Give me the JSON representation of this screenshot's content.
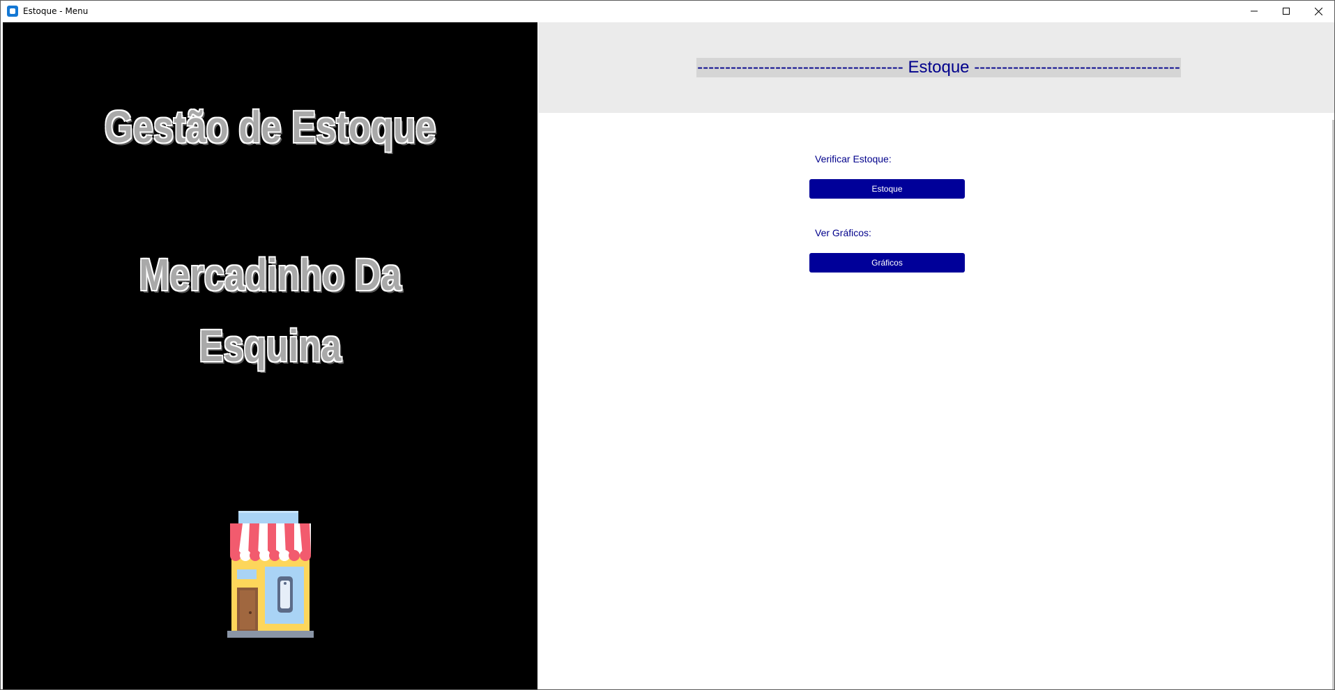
{
  "window": {
    "title": "Estoque - Menu",
    "controls": [
      "minimize-icon",
      "maximize-icon",
      "close-icon"
    ]
  },
  "left_panel": {
    "heading_line1": "Gestão de Estoque",
    "heading_line2": "Mercadinho Da",
    "heading_line3": "Esquina",
    "image": "storefront-icon"
  },
  "right_panel": {
    "header": "------------------------------------- Estoque -------------------------------------",
    "verificar_label": "Verificar Estoque:",
    "estoque_button": "Estoque",
    "graficos_label": "Ver Gráficos:",
    "graficos_button": "Gráficos"
  },
  "colors": {
    "accent": "#000099",
    "label_text": "#00008b",
    "left_background": "#000000",
    "header_background": "#ebebeb"
  }
}
